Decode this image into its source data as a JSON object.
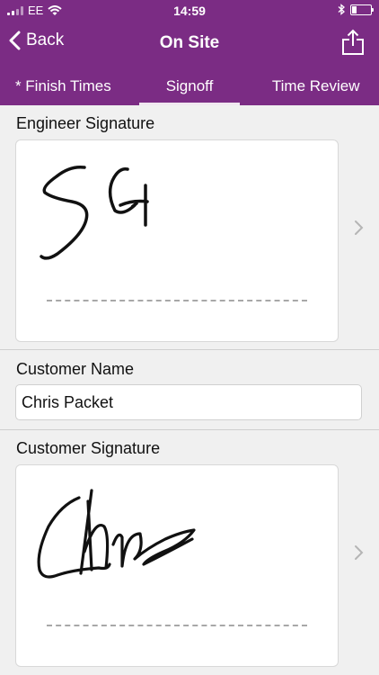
{
  "status_bar": {
    "carrier": "EE",
    "time": "14:59"
  },
  "nav": {
    "back_label": "Back",
    "title": "On Site"
  },
  "tabs": [
    {
      "label": "* Finish Times",
      "active": false
    },
    {
      "label": "Signoff",
      "active": true
    },
    {
      "label": "Time Review",
      "active": false
    }
  ],
  "form": {
    "engineer_signature_label": "Engineer Signature",
    "engineer_signature_text": "SG",
    "customer_name_label": "Customer Name",
    "customer_name_value": "Chris Packet",
    "customer_signature_label": "Customer Signature",
    "customer_signature_text": "Chris"
  },
  "colors": {
    "accent": "#7b2c84",
    "background": "#f0f0f0"
  }
}
